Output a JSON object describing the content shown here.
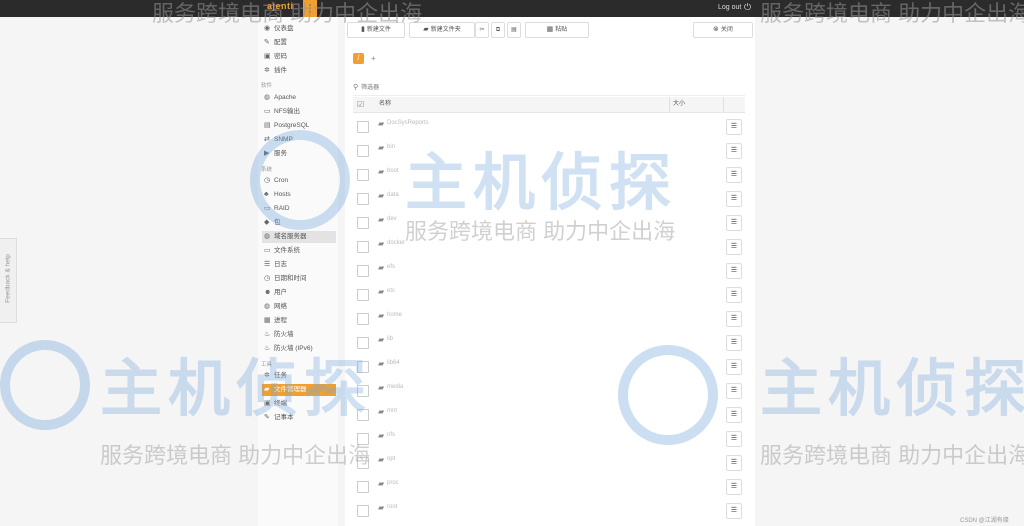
{
  "app": {
    "logo": "ajenti",
    "logout_label": "Log out"
  },
  "sidebar": {
    "items": [
      {
        "label": "仪表盘",
        "icon": "dashboard-icon"
      },
      {
        "label": "配置",
        "icon": "wrench-icon"
      },
      {
        "label": "密码",
        "icon": "lock-icon"
      },
      {
        "label": "插件",
        "icon": "gears-icon"
      }
    ],
    "group_software": "软件",
    "software_items": [
      {
        "label": "Apache",
        "icon": "globe-icon"
      },
      {
        "label": "NFS输出",
        "icon": "hdd-icon"
      },
      {
        "label": "PostgreSQL",
        "icon": "database-icon"
      },
      {
        "label": "SNMP",
        "icon": "exchange-icon"
      },
      {
        "label": "服务",
        "icon": "play-icon"
      }
    ],
    "group_system": "系统",
    "system_items": [
      {
        "label": "Cron",
        "icon": "clock-icon"
      },
      {
        "label": "Hosts",
        "icon": "sitemap-icon"
      },
      {
        "label": "RAID",
        "icon": "hdd-icon"
      },
      {
        "label": "包",
        "icon": "gift-icon"
      },
      {
        "label": "域名服务器",
        "icon": "globe-icon"
      },
      {
        "label": "文件系统",
        "icon": "hdd-icon"
      },
      {
        "label": "日志",
        "icon": "list-icon"
      },
      {
        "label": "日期和时间",
        "icon": "clock-icon"
      },
      {
        "label": "用户",
        "icon": "group-icon"
      },
      {
        "label": "网络",
        "icon": "globe-icon"
      },
      {
        "label": "进程",
        "icon": "th-icon"
      },
      {
        "label": "防火墙",
        "icon": "fire-icon"
      },
      {
        "label": "防火墙 (IPv6)",
        "icon": "fire-icon"
      }
    ],
    "group_tools": "工具",
    "tools_items": [
      {
        "label": "任务",
        "icon": "cog-icon"
      },
      {
        "label": "文件管理器",
        "icon": "folder-icon"
      },
      {
        "label": "终端",
        "icon": "terminal-icon"
      },
      {
        "label": "记事本",
        "icon": "edit-icon"
      }
    ]
  },
  "toolbar": {
    "new_file": "新建文件",
    "new_folder": "新建文件夹",
    "paste": "粘贴",
    "close": "关闭"
  },
  "path": {
    "root": "/",
    "add": "+"
  },
  "filter": {
    "placeholder": "筛选器"
  },
  "table": {
    "col_name": "名称",
    "col_size": "大小",
    "rows": [
      "DocSysReports",
      "bin",
      "boot",
      "data",
      "dev",
      "docker",
      "efs",
      "etc",
      "home",
      "lib",
      "lib64",
      "media",
      "mnt",
      "nfs",
      "opt",
      "proc",
      "root"
    ]
  },
  "watermark": {
    "brand": "主机侦探",
    "slogan": "服务跨境电商 助力中企出海"
  },
  "feedback": "Feedback & help",
  "csdn": "CSDN @江湖有缘",
  "colors": {
    "accent": "#f0a030",
    "topbar": "#2b2b2b"
  }
}
